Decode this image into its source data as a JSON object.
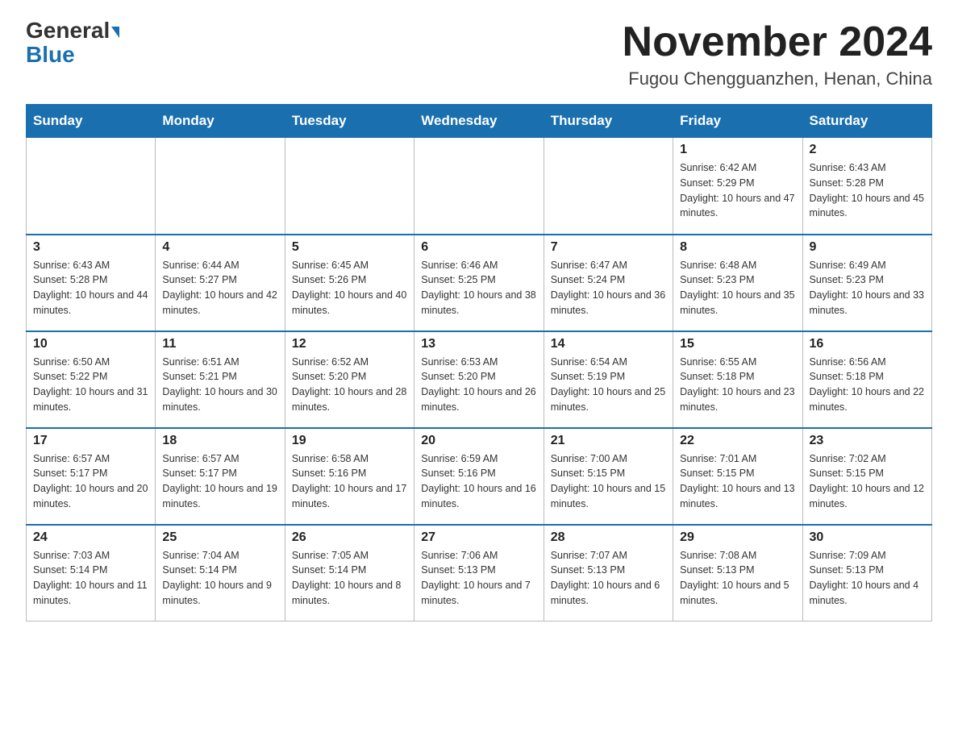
{
  "logo": {
    "part1": "General",
    "part2": "Blue"
  },
  "title": "November 2024",
  "subtitle": "Fugou Chengguanzhen, Henan, China",
  "days_of_week": [
    "Sunday",
    "Monday",
    "Tuesday",
    "Wednesday",
    "Thursday",
    "Friday",
    "Saturday"
  ],
  "weeks": [
    [
      {
        "day": "",
        "info": ""
      },
      {
        "day": "",
        "info": ""
      },
      {
        "day": "",
        "info": ""
      },
      {
        "day": "",
        "info": ""
      },
      {
        "day": "",
        "info": ""
      },
      {
        "day": "1",
        "info": "Sunrise: 6:42 AM\nSunset: 5:29 PM\nDaylight: 10 hours and 47 minutes."
      },
      {
        "day": "2",
        "info": "Sunrise: 6:43 AM\nSunset: 5:28 PM\nDaylight: 10 hours and 45 minutes."
      }
    ],
    [
      {
        "day": "3",
        "info": "Sunrise: 6:43 AM\nSunset: 5:28 PM\nDaylight: 10 hours and 44 minutes."
      },
      {
        "day": "4",
        "info": "Sunrise: 6:44 AM\nSunset: 5:27 PM\nDaylight: 10 hours and 42 minutes."
      },
      {
        "day": "5",
        "info": "Sunrise: 6:45 AM\nSunset: 5:26 PM\nDaylight: 10 hours and 40 minutes."
      },
      {
        "day": "6",
        "info": "Sunrise: 6:46 AM\nSunset: 5:25 PM\nDaylight: 10 hours and 38 minutes."
      },
      {
        "day": "7",
        "info": "Sunrise: 6:47 AM\nSunset: 5:24 PM\nDaylight: 10 hours and 36 minutes."
      },
      {
        "day": "8",
        "info": "Sunrise: 6:48 AM\nSunset: 5:23 PM\nDaylight: 10 hours and 35 minutes."
      },
      {
        "day": "9",
        "info": "Sunrise: 6:49 AM\nSunset: 5:23 PM\nDaylight: 10 hours and 33 minutes."
      }
    ],
    [
      {
        "day": "10",
        "info": "Sunrise: 6:50 AM\nSunset: 5:22 PM\nDaylight: 10 hours and 31 minutes."
      },
      {
        "day": "11",
        "info": "Sunrise: 6:51 AM\nSunset: 5:21 PM\nDaylight: 10 hours and 30 minutes."
      },
      {
        "day": "12",
        "info": "Sunrise: 6:52 AM\nSunset: 5:20 PM\nDaylight: 10 hours and 28 minutes."
      },
      {
        "day": "13",
        "info": "Sunrise: 6:53 AM\nSunset: 5:20 PM\nDaylight: 10 hours and 26 minutes."
      },
      {
        "day": "14",
        "info": "Sunrise: 6:54 AM\nSunset: 5:19 PM\nDaylight: 10 hours and 25 minutes."
      },
      {
        "day": "15",
        "info": "Sunrise: 6:55 AM\nSunset: 5:18 PM\nDaylight: 10 hours and 23 minutes."
      },
      {
        "day": "16",
        "info": "Sunrise: 6:56 AM\nSunset: 5:18 PM\nDaylight: 10 hours and 22 minutes."
      }
    ],
    [
      {
        "day": "17",
        "info": "Sunrise: 6:57 AM\nSunset: 5:17 PM\nDaylight: 10 hours and 20 minutes."
      },
      {
        "day": "18",
        "info": "Sunrise: 6:57 AM\nSunset: 5:17 PM\nDaylight: 10 hours and 19 minutes."
      },
      {
        "day": "19",
        "info": "Sunrise: 6:58 AM\nSunset: 5:16 PM\nDaylight: 10 hours and 17 minutes."
      },
      {
        "day": "20",
        "info": "Sunrise: 6:59 AM\nSunset: 5:16 PM\nDaylight: 10 hours and 16 minutes."
      },
      {
        "day": "21",
        "info": "Sunrise: 7:00 AM\nSunset: 5:15 PM\nDaylight: 10 hours and 15 minutes."
      },
      {
        "day": "22",
        "info": "Sunrise: 7:01 AM\nSunset: 5:15 PM\nDaylight: 10 hours and 13 minutes."
      },
      {
        "day": "23",
        "info": "Sunrise: 7:02 AM\nSunset: 5:15 PM\nDaylight: 10 hours and 12 minutes."
      }
    ],
    [
      {
        "day": "24",
        "info": "Sunrise: 7:03 AM\nSunset: 5:14 PM\nDaylight: 10 hours and 11 minutes."
      },
      {
        "day": "25",
        "info": "Sunrise: 7:04 AM\nSunset: 5:14 PM\nDaylight: 10 hours and 9 minutes."
      },
      {
        "day": "26",
        "info": "Sunrise: 7:05 AM\nSunset: 5:14 PM\nDaylight: 10 hours and 8 minutes."
      },
      {
        "day": "27",
        "info": "Sunrise: 7:06 AM\nSunset: 5:13 PM\nDaylight: 10 hours and 7 minutes."
      },
      {
        "day": "28",
        "info": "Sunrise: 7:07 AM\nSunset: 5:13 PM\nDaylight: 10 hours and 6 minutes."
      },
      {
        "day": "29",
        "info": "Sunrise: 7:08 AM\nSunset: 5:13 PM\nDaylight: 10 hours and 5 minutes."
      },
      {
        "day": "30",
        "info": "Sunrise: 7:09 AM\nSunset: 5:13 PM\nDaylight: 10 hours and 4 minutes."
      }
    ]
  ]
}
